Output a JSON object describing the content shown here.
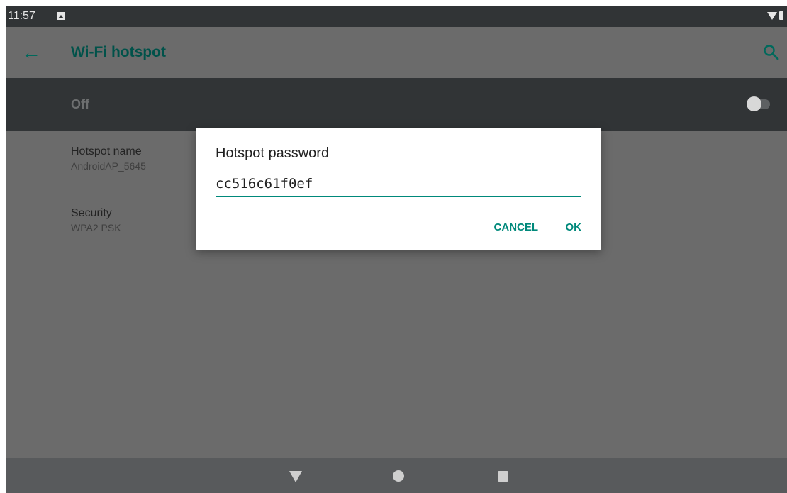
{
  "status_bar": {
    "time": "11:57",
    "image_notification_icon": "image-icon",
    "wifi_icon": "wifi-icon",
    "battery_icon": "battery-icon"
  },
  "app_bar": {
    "title": "Wi-Fi hotspot",
    "back_icon": "arrow-back-icon",
    "search_icon": "search-icon"
  },
  "switch_bar": {
    "label": "Off",
    "enabled": false
  },
  "settings": [
    {
      "title": "Hotspot name",
      "summary": "AndroidAP_5645"
    },
    {
      "title": "Security",
      "summary": "WPA2 PSK"
    }
  ],
  "dialog": {
    "title": "Hotspot password",
    "password_value": "cc516c61f0ef",
    "cancel_label": "CANCEL",
    "ok_label": "OK"
  },
  "nav_bar": {
    "back_icon": "nav-back-icon",
    "home_icon": "nav-home-icon",
    "recents_icon": "nav-recents-icon"
  },
  "colors": {
    "accent": "#00897b",
    "title_teal": "#00524a",
    "scrim": "#6b6b6b",
    "dark_bar": "#313436"
  }
}
